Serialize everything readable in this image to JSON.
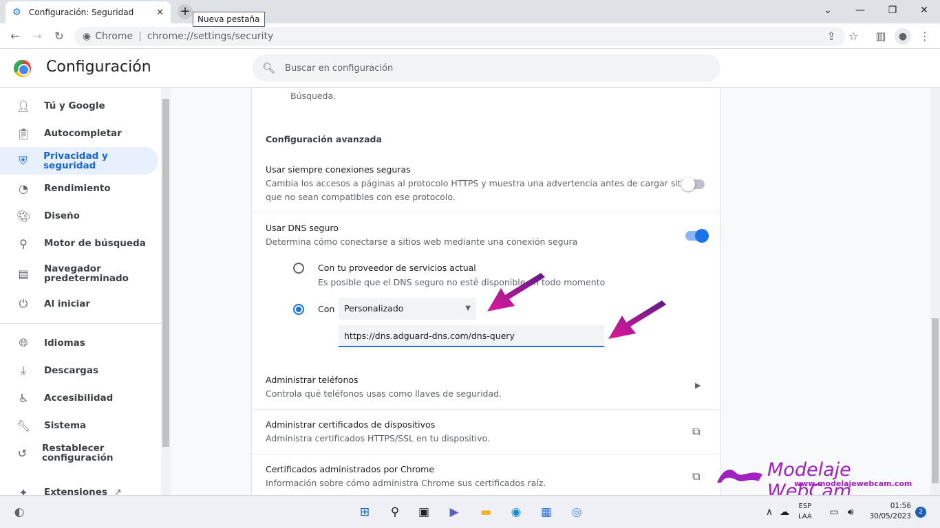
{
  "browser": {
    "tab_title": "Configuración: Seguridad",
    "tab_close": "✕",
    "new_tab_symbol": "+",
    "tooltip": "Nueva pestaña",
    "site_name": "Chrome",
    "url": "chrome://settings/security"
  },
  "header": {
    "title": "Configuración",
    "search_placeholder": "Buscar en configuración"
  },
  "sidebar": {
    "items": [
      {
        "label": "Tú y Google",
        "icon": "person-icon"
      },
      {
        "label": "Autocompletar",
        "icon": "clipboard-icon"
      },
      {
        "label": "Privacidad y seguridad",
        "icon": "shield-icon",
        "active": true
      },
      {
        "label": "Rendimiento",
        "icon": "speedometer-icon"
      },
      {
        "label": "Diseño",
        "icon": "palette-icon"
      },
      {
        "label": "Motor de búsqueda",
        "icon": "search-icon"
      },
      {
        "label": "Navegador predeterminado",
        "icon": "browser-icon"
      },
      {
        "label": "Al iniciar",
        "icon": "power-icon"
      },
      {
        "label": "Idiomas",
        "icon": "globe-icon"
      },
      {
        "label": "Descargas",
        "icon": "download-icon"
      },
      {
        "label": "Accesibilidad",
        "icon": "accessibility-icon"
      },
      {
        "label": "Sistema",
        "icon": "wrench-icon"
      },
      {
        "label": "Restablecer configuración",
        "icon": "restore-icon"
      },
      {
        "label": "Extensiones",
        "icon": "puzzle-icon"
      }
    ]
  },
  "content": {
    "top_fragment": "Búsqueda.",
    "advanced_heading": "Configuración avanzada",
    "https_title": "Usar siempre conexiones seguras",
    "https_desc_line1": "Cambia los accesos a páginas al protocolo HTTPS y muestra una advertencia antes de cargar sitios",
    "https_desc_line2": "que no sean compatibles con ese protocolo.",
    "https_enabled": false,
    "dns_title": "Usar DNS seguro",
    "dns_desc": "Determina cómo conectarse a sitios web mediante una conexión segura",
    "dns_enabled": true,
    "radio_current_title": "Con tu proveedor de servicios actual",
    "radio_current_desc": "Es posible que el DNS seguro no esté disponible en todo momento",
    "radio_custom_label": "Con",
    "dns_provider_selected": "Personalizado",
    "dns_custom_url": "https://dns.adguard-dns.com/dns-query",
    "phones_title": "Administrar teléfonos",
    "phones_desc": "Controla qué teléfonos usas como llaves de seguridad.",
    "certs_title": "Administrar certificados de dispositivos",
    "certs_desc": "Administra certificados HTTPS/SSL en tu dispositivo.",
    "chrome_certs_title": "Certificados administrados por Chrome",
    "chrome_certs_desc": "Información sobre cómo administra Chrome sus certificados raíz."
  },
  "watermark": {
    "brand": "Modelaje WebCam",
    "url": "www.modelajewebcam.com",
    "color": "#a020c0"
  },
  "taskbar": {
    "lang_line1": "ESP",
    "lang_line2": "LAA",
    "time": "01:56",
    "date": "30/05/2023",
    "notifications": "2"
  },
  "colors": {
    "accent": "#1a73e8",
    "active_nav_bg": "#e8f0fe",
    "arrow": "#c21aa0"
  }
}
